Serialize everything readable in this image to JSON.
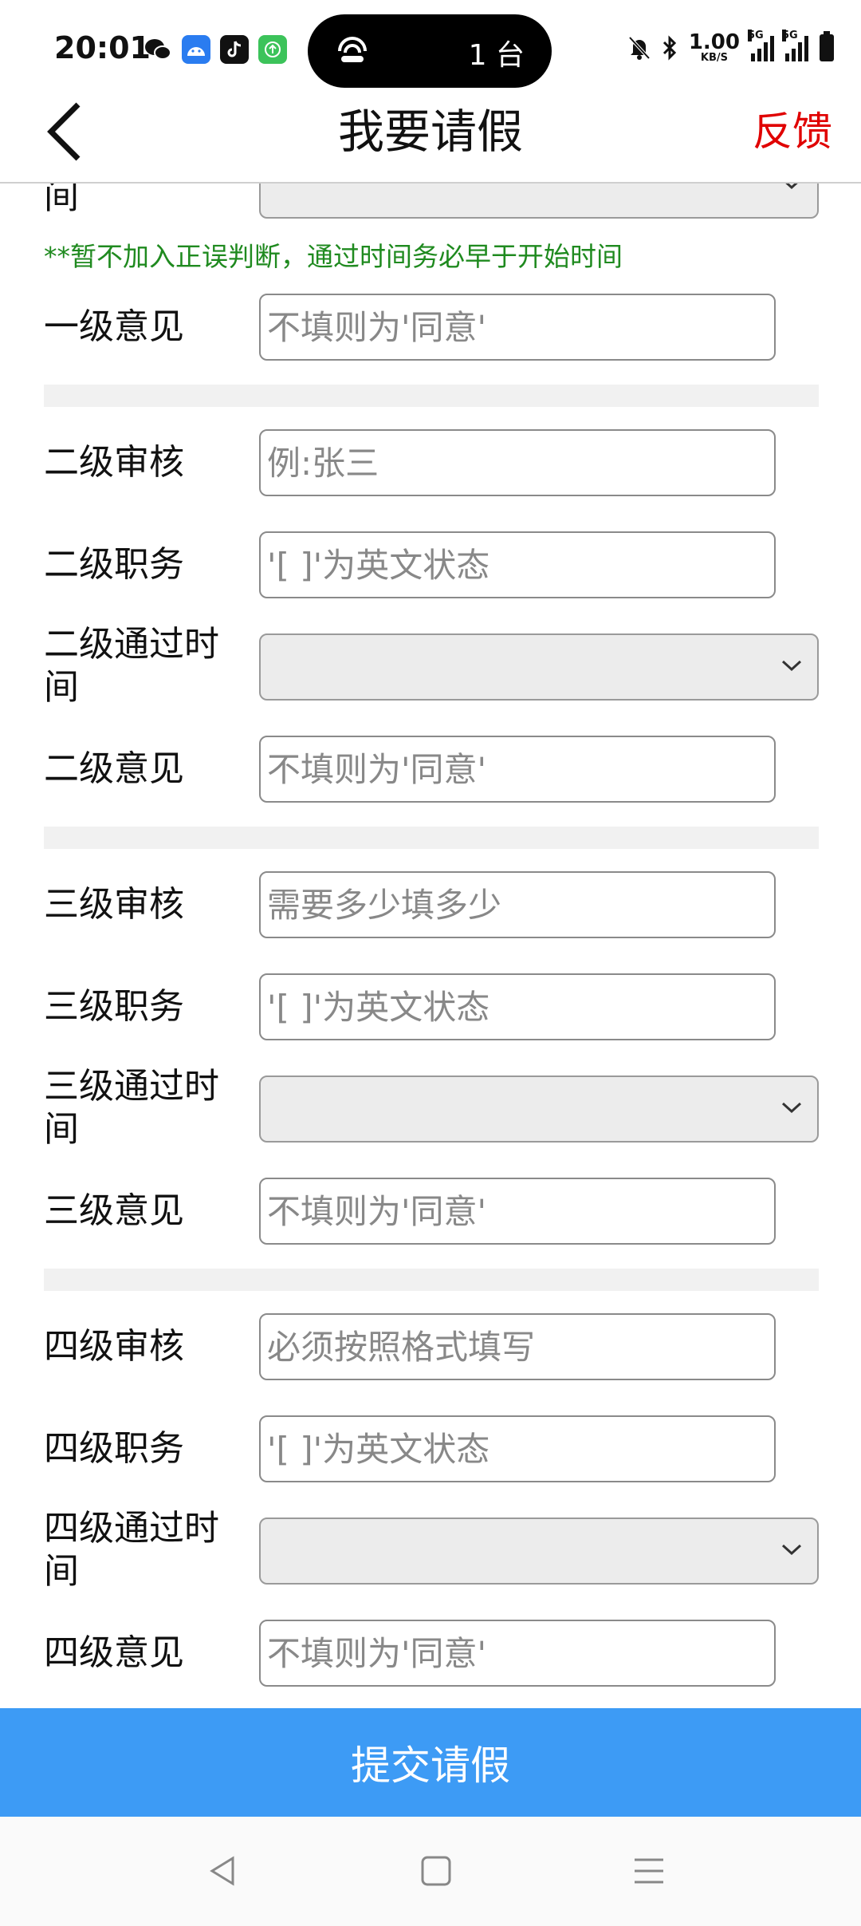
{
  "status_bar": {
    "time": "20:01",
    "pill_text": "1 台",
    "net_speed": "1.00",
    "net_unit": "KB/S",
    "sim1_tag": "5G",
    "sim2_tag": "5G"
  },
  "header": {
    "title": "我要请假",
    "feedback_label": "反馈"
  },
  "form": {
    "partial_label": "间",
    "note": "**暂不加入正误判断，通过时间务必早于开始时间",
    "level1": {
      "opinion_label": "一级意见",
      "opinion_placeholder": "不填则为'同意'"
    },
    "level2": {
      "reviewer_label": "二级审核",
      "reviewer_placeholder": "例:张三",
      "position_label": "二级职务",
      "position_placeholder": "'[ ]'为英文状态",
      "pass_time_label_1": "二级通过时",
      "pass_time_label_2": "间",
      "opinion_label": "二级意见",
      "opinion_placeholder": "不填则为'同意'"
    },
    "level3": {
      "reviewer_label": "三级审核",
      "reviewer_placeholder": "需要多少填多少",
      "position_label": "三级职务",
      "position_placeholder": "'[ ]'为英文状态",
      "pass_time_label_1": "三级通过时",
      "pass_time_label_2": "间",
      "opinion_label": "三级意见",
      "opinion_placeholder": "不填则为'同意'"
    },
    "level4": {
      "reviewer_label": "四级审核",
      "reviewer_placeholder": "必须按照格式填写",
      "position_label": "四级职务",
      "position_placeholder": "'[ ]'为英文状态",
      "pass_time_label_1": "四级通过时",
      "pass_time_label_2": "间",
      "opinion_label": "四级意见",
      "opinion_placeholder": "不填则为'同意'"
    }
  },
  "submit_label": "提交请假",
  "colors": {
    "accent": "#3d9bf5",
    "feedback": "#e00000",
    "note": "#1f8a1f"
  },
  "icons": [
    "back-chevron-icon",
    "chevron-down-icon",
    "nav-back-icon",
    "nav-home-icon",
    "nav-menu-icon"
  ]
}
